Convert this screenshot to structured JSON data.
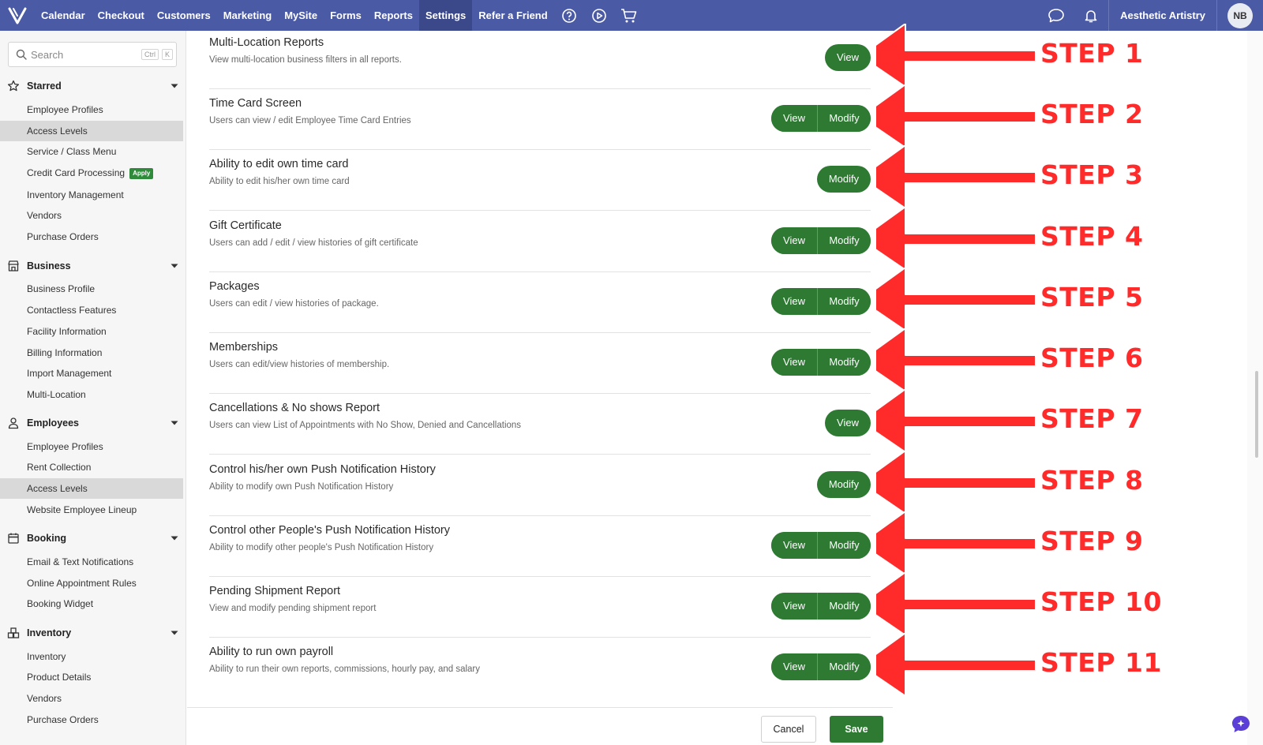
{
  "topbar": {
    "nav": [
      "Calendar",
      "Checkout",
      "Customers",
      "Marketing",
      "MySite",
      "Forms",
      "Reports",
      "Settings",
      "Refer a Friend"
    ],
    "active": "Settings",
    "business_name": "Aesthetic Artistry",
    "avatar_initials": "NB"
  },
  "sidebar": {
    "search_placeholder": "Search",
    "shortcut_ctrl": "Ctrl",
    "shortcut_key": "K",
    "sections": [
      {
        "title": "Starred",
        "icon": "star-icon",
        "items": [
          "Employee Profiles",
          "Access Levels",
          "Service / Class Menu",
          "Credit Card Processing",
          "Inventory Management",
          "Vendors",
          "Purchase Orders"
        ]
      },
      {
        "title": "Business",
        "icon": "store-icon",
        "items": [
          "Business Profile",
          "Contactless Features",
          "Facility Information",
          "Billing Information",
          "Import Management",
          "Multi-Location"
        ]
      },
      {
        "title": "Employees",
        "icon": "person-icon",
        "items": [
          "Employee Profiles",
          "Rent Collection",
          "Access Levels",
          "Website Employee Lineup"
        ]
      },
      {
        "title": "Booking",
        "icon": "calendar-icon",
        "items": [
          "Email & Text Notifications",
          "Online Appointment Rules",
          "Booking Widget"
        ]
      },
      {
        "title": "Inventory",
        "icon": "boxes-icon",
        "items": [
          "Inventory",
          "Product Details",
          "Vendors",
          "Purchase Orders"
        ]
      }
    ],
    "apply_badge": "Apply"
  },
  "permissions": [
    {
      "title": "Multi-Location Reports",
      "desc": "View multi-location business filters in all reports.",
      "buttons": [
        "View"
      ]
    },
    {
      "title": "Time Card Screen",
      "desc": "Users can view / edit Employee Time Card Entries",
      "buttons": [
        "View",
        "Modify"
      ]
    },
    {
      "title": "Ability to edit own time card",
      "desc": "Ability to edit his/her own time card",
      "buttons": [
        "Modify"
      ]
    },
    {
      "title": "Gift Certificate",
      "desc": "Users can add / edit / view histories of gift certificate",
      "buttons": [
        "View",
        "Modify"
      ]
    },
    {
      "title": "Packages",
      "desc": "Users can edit / view histories of package.",
      "buttons": [
        "View",
        "Modify"
      ]
    },
    {
      "title": "Memberships",
      "desc": "Users can edit/view histories of membership.",
      "buttons": [
        "View",
        "Modify"
      ]
    },
    {
      "title": "Cancellations & No shows Report",
      "desc": "Users can view List of Appointments with No Show, Denied and Cancellations",
      "buttons": [
        "View"
      ]
    },
    {
      "title": "Control his/her own Push Notification History",
      "desc": "Ability to modify own Push Notification History",
      "buttons": [
        "Modify"
      ]
    },
    {
      "title": "Control other People's Push Notification History",
      "desc": "Ability to modify other people's Push Notification History",
      "buttons": [
        "View",
        "Modify"
      ]
    },
    {
      "title": "Pending Shipment Report",
      "desc": "View and modify pending shipment report",
      "buttons": [
        "View",
        "Modify"
      ]
    },
    {
      "title": "Ability to run own payroll",
      "desc": "Ability to run their own reports, commissions, hourly pay, and salary",
      "buttons": [
        "View",
        "Modify"
      ]
    }
  ],
  "footer": {
    "cancel": "Cancel",
    "save": "Save"
  },
  "steps": [
    "STEP 1",
    "STEP 2",
    "STEP 3",
    "STEP 4",
    "STEP 5",
    "STEP 6",
    "STEP 7",
    "STEP 8",
    "STEP 9",
    "STEP 10",
    "STEP 11"
  ],
  "colors": {
    "topbar": "#4b5aa4",
    "button_green": "#2e7a33",
    "annotation_red": "#ff2b2b"
  }
}
